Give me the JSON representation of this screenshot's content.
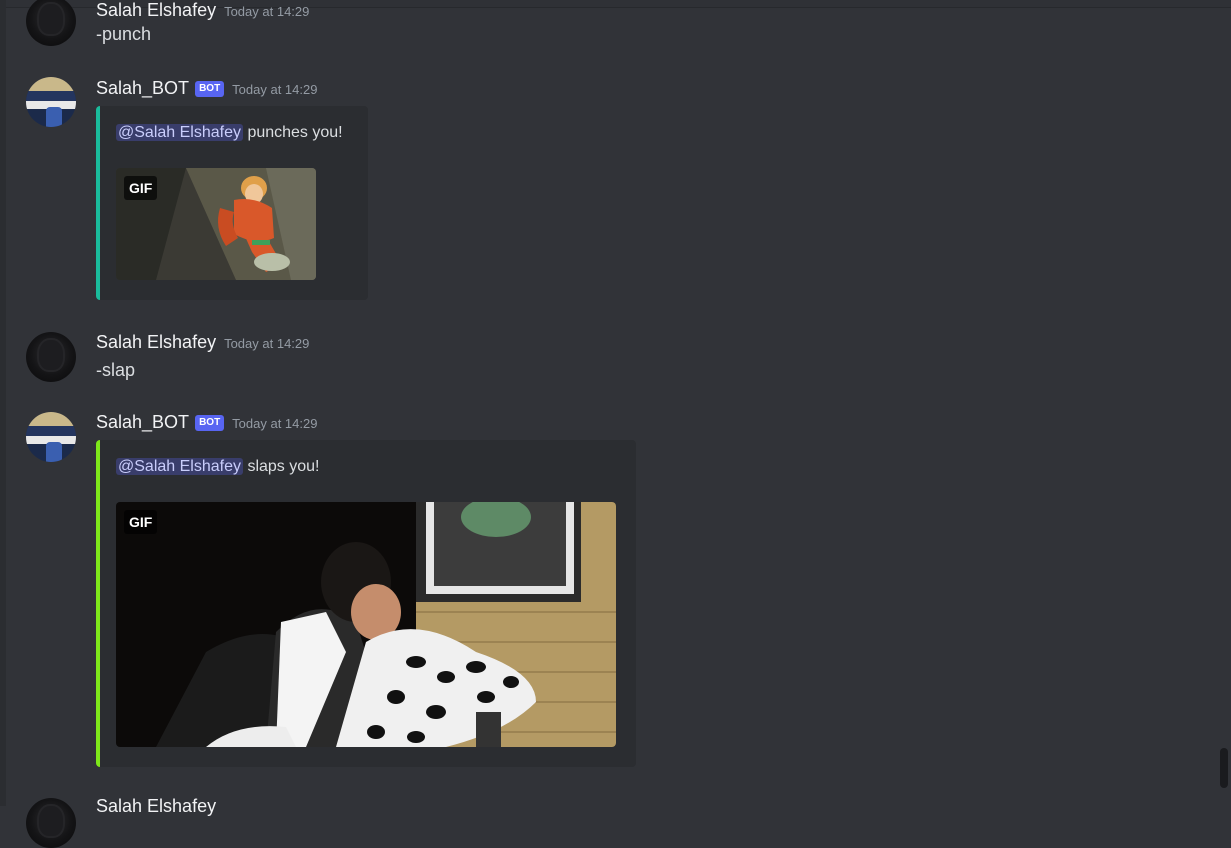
{
  "messages": [
    {
      "author": "Salah Elshafey",
      "timestamp": "Today at 14:29",
      "content": "-punch",
      "avatar": "user-avatar"
    },
    {
      "author": "Salah_BOT",
      "bot_tag": "BOT",
      "timestamp": "Today at 14:29",
      "avatar": "bot-avatar",
      "embed": {
        "mention": "@Salah Elshafey",
        "text": "punches you!",
        "accent": "#1abc9c",
        "gif_badge": "GIF",
        "gif_description": "orange-jumpsuit-cartoon-punch"
      }
    },
    {
      "author": "Salah Elshafey",
      "timestamp": "Today at 14:29",
      "content": "-slap",
      "avatar": "user-avatar"
    },
    {
      "author": "Salah_BOT",
      "bot_tag": "BOT",
      "timestamp": "Today at 14:29",
      "avatar": "bot-avatar",
      "embed": {
        "mention": "@Salah Elshafey",
        "text": "slaps you!",
        "accent": "#7ee81a",
        "gif_badge": "GIF",
        "gif_description": "sitcom-slap-scene"
      }
    },
    {
      "author": "Salah Elshafey",
      "avatar": "user-avatar"
    }
  ],
  "colors": {
    "background": "#313338",
    "embed_background": "#2b2d31",
    "bot_tag": "#5865f2",
    "mention_bg": "#3c4270"
  }
}
